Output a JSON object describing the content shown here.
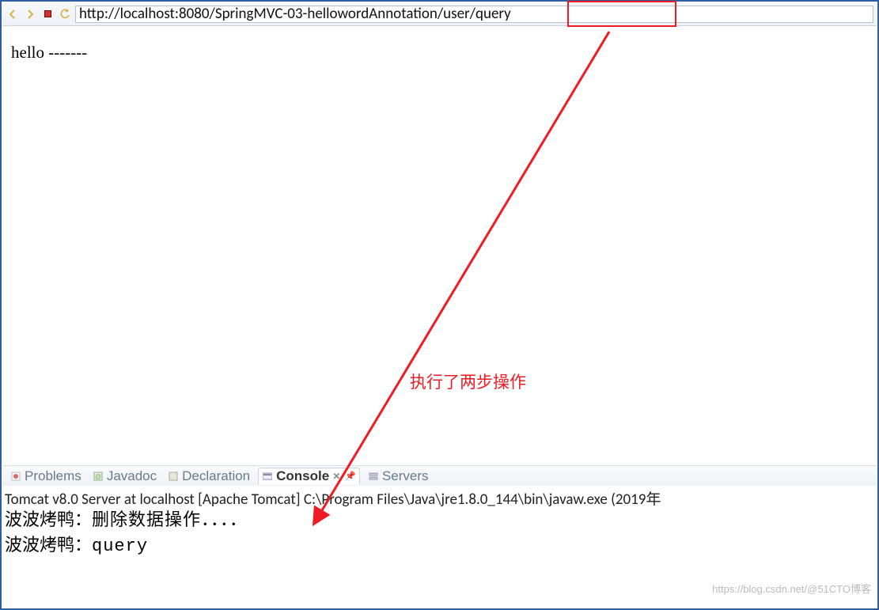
{
  "toolbar": {
    "url": "http://localhost:8080/SpringMVC-03-hellowordAnnotation/user/query"
  },
  "page": {
    "body_text": "hello -------"
  },
  "annotation": {
    "text": "执行了两步操作"
  },
  "tabs": {
    "problems": "Problems",
    "javadoc": "Javadoc",
    "declaration": "Declaration",
    "console": "Console",
    "servers": "Servers"
  },
  "console": {
    "process_desc": "Tomcat v8.0 Server at localhost [Apache Tomcat] C:\\Program Files\\Java\\jre1.8.0_144\\bin\\javaw.exe (2019年",
    "line1_prefix": "波波烤鸭：",
    "line1_text": "删除数据操作．．．．",
    "line2_prefix": "波波烤鸭：",
    "line2_text": "query"
  },
  "watermark": "https://blog.csdn.net/@51CTO博客"
}
